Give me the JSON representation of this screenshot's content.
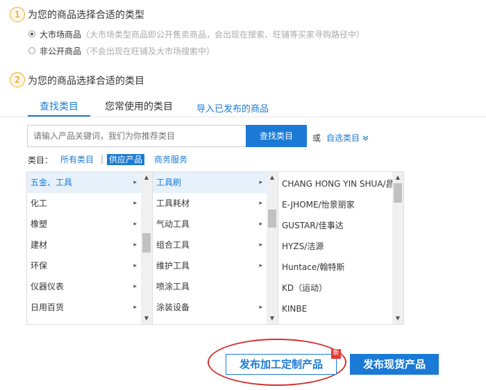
{
  "step1": {
    "number": "1",
    "title": "为您的商品选择合适的类型"
  },
  "radios": [
    {
      "label": "大市场商品",
      "desc": "（大市场类型商品即公开售卖商品，会出现在搜索、旺铺等买家寻购路径中）",
      "checked": true
    },
    {
      "label": "非公开商品",
      "desc": "（不会出现在旺铺及大市场搜索中）",
      "checked": false
    }
  ],
  "step2": {
    "number": "2",
    "title": "为您的商品选择合适的类目"
  },
  "tabs": [
    {
      "label": "查找类目",
      "active": true
    },
    {
      "label": "您常使用的类目",
      "active": false
    }
  ],
  "import_link": "导入已发布的商品",
  "search": {
    "placeholder": "请输入产品关键词，我们为你推荐类目",
    "button": "查找类目",
    "or": "或",
    "custom": "自选类目",
    "custom_icon": "chevron-down-icon"
  },
  "category_filter": {
    "label": "类目：",
    "options": [
      "所有类目",
      "供应产品",
      "商务服务"
    ],
    "active_index": 1,
    "separator": "|"
  },
  "col1": [
    "五金、工具",
    "化工",
    "橡塑",
    "建材",
    "环保",
    "仪器仪表",
    "日用百货",
    "…"
  ],
  "col2": [
    "工具刷",
    "工具耗材",
    "气动工具",
    "组合工具",
    "维护工具",
    "喷涂工具",
    "涂装设备",
    "…"
  ],
  "col3": [
    "CHANG HONG YIN SHUA/昌弘",
    "E-JHOME/怡景丽家",
    "GUSTAR/佳事达",
    "HYZS/洁源",
    "Huntace/翰特斯",
    "KD（运动）",
    "KINBE"
  ],
  "buttons": {
    "custom_product": "发布加工定制产品",
    "new_badge": "新",
    "spot_product": "发布现货产品"
  },
  "colors": {
    "accent": "#1a7ad6",
    "highlight": "#d32f2f",
    "step": "#f5a623"
  }
}
